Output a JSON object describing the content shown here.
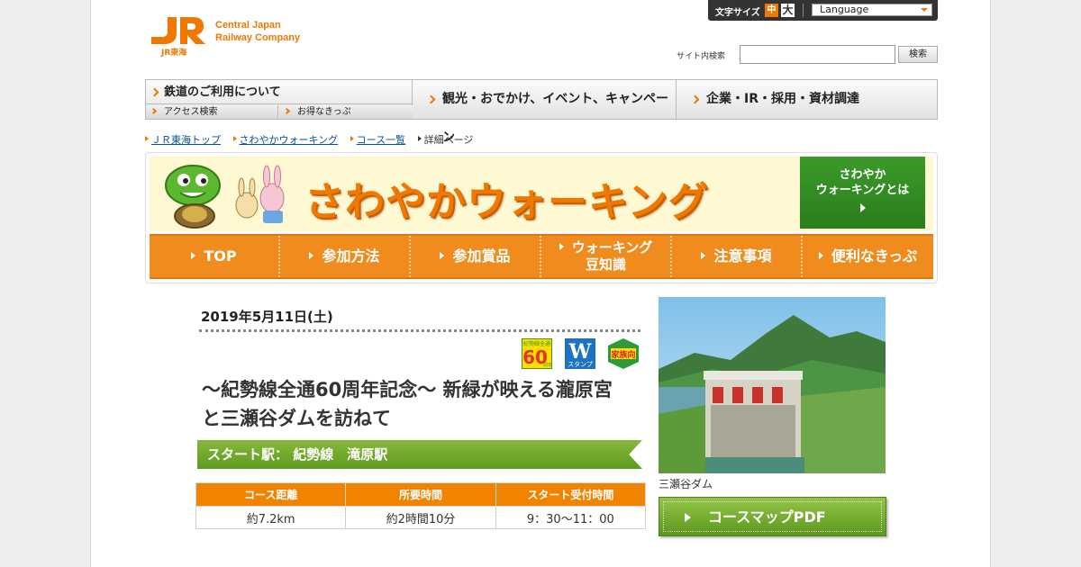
{
  "header": {
    "logo_mark": "JR",
    "logo_name_line1": "Central Japan",
    "logo_name_line2": "Railway Company",
    "logo_sub": "JR東海",
    "font_size_label": "文字サイズ",
    "font_size_mid": "中",
    "font_size_large": "大",
    "language_select": "Language",
    "search_label": "サイト内検索",
    "search_placeholder": "",
    "search_button": "検索"
  },
  "global_nav": {
    "rail": "鉄道のご利用について",
    "access_search": "アクセス検索",
    "discount_tickets": "お得なきっぷ",
    "tourism": "観光・おでかけ、イベント、キャンペーン",
    "corporate": "企業・IR・採用・資材調達"
  },
  "breadcrumb": [
    "ＪＲ東海トップ",
    "さわやかウォーキング",
    "コース一覧",
    "詳細ページ"
  ],
  "walking": {
    "title": "さわやかウォーキング",
    "about_line1": "さわやか",
    "about_line2": "ウォーキングとは",
    "nav": [
      "TOP",
      "参加方法",
      "参加賞品",
      "ウォーキング",
      "豆知識",
      "注意事項",
      "便利なきっぷ"
    ]
  },
  "event": {
    "date": "2019年5月11日(土)",
    "badges": {
      "anniversary_top": "紀勢線全通",
      "anniversary_num": "60",
      "anniversary_bottom": "周年",
      "stamp_letter": "W",
      "stamp_label": "スタンプ",
      "family_label": "家族向"
    },
    "title_line1": "～紀勢線全通60周年記念～ 新緑が映える瀧原宮",
    "title_line2": "と三瀬谷ダムを訪ねて",
    "start_station": "スタート駅： 紀勢線　滝原駅",
    "table_headers": [
      "コース距離",
      "所要時間",
      "スタート受付時間"
    ],
    "table_values": [
      "約7.2km",
      "約2時間10分",
      "9：30～11：00"
    ],
    "photo_caption": "三瀬谷ダム",
    "pdf_button": "コースマップPDF"
  },
  "colors": {
    "accent_orange": "#f07800",
    "walking_green": "#5e9a1e",
    "table_header": "#f08400"
  }
}
